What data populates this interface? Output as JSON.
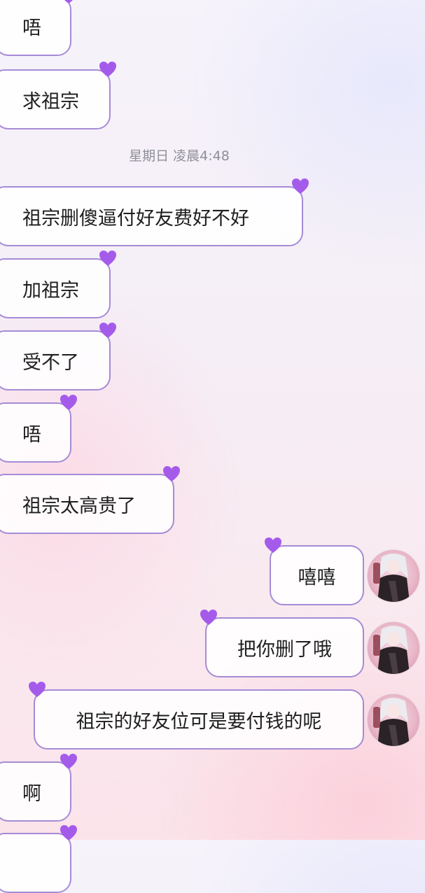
{
  "chat": {
    "timestamp": "星期日 凌晨4:48",
    "messages": [
      {
        "side": "in",
        "text": "唔"
      },
      {
        "side": "in",
        "text": "求祖宗"
      },
      {
        "side": "in",
        "text": "祖宗删傻逼付好友费好不好"
      },
      {
        "side": "in",
        "text": "加祖宗"
      },
      {
        "side": "in",
        "text": "受不了"
      },
      {
        "side": "in",
        "text": "唔"
      },
      {
        "side": "in",
        "text": "祖宗太高贵了"
      },
      {
        "side": "out",
        "text": "嘻嘻"
      },
      {
        "side": "out",
        "text": "把你删了哦"
      },
      {
        "side": "out",
        "text": "祖宗的好友位可是要付钱的呢"
      },
      {
        "side": "in",
        "text": "啊"
      }
    ]
  },
  "icons": {
    "bubble_decoration": "purple-heart-icon",
    "avatar": "anime-girl-avatar"
  },
  "colors": {
    "bubble_border": "#a58bd6",
    "heart": "#a55bea",
    "background_pink": "#fbe3ea"
  }
}
